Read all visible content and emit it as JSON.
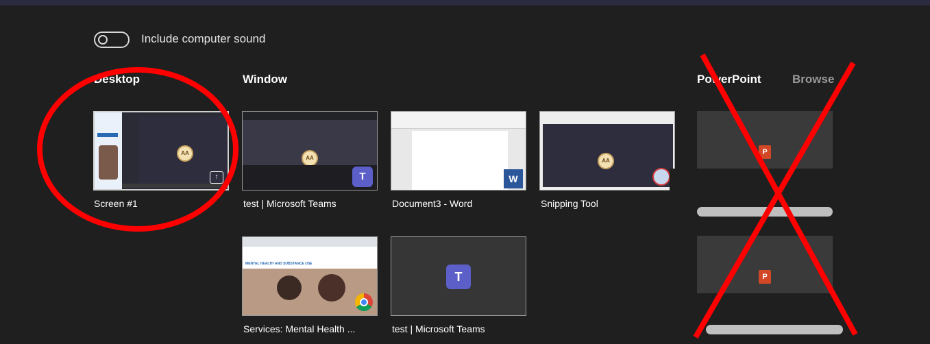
{
  "sound": {
    "label": "Include computer sound",
    "enabled": false
  },
  "sections": {
    "desktop": "Desktop",
    "window": "Window",
    "powerpoint": "PowerPoint",
    "browse": "Browse"
  },
  "desktop_items": [
    {
      "caption": "Screen #1",
      "avatar": "AA"
    }
  ],
  "window_items": [
    {
      "caption": "test | Microsoft Teams",
      "avatar": "AA",
      "badge": "T"
    },
    {
      "caption": "Document3 - Word",
      "badge": "W"
    },
    {
      "caption": "Snipping Tool",
      "avatar": "AA"
    },
    {
      "caption": "Services: Mental Health ...",
      "page_heading": "MENTAL HEALTH AND SUBSTANCE USE"
    },
    {
      "caption": "test | Microsoft Teams",
      "badge": "T"
    }
  ],
  "powerpoint_items": [
    {
      "icon": "P"
    },
    {
      "icon": "P"
    }
  ],
  "colors": {
    "annotation": "#ff0000",
    "background": "#1f1f1f",
    "teams": "#5b5fc7",
    "word": "#2b579a",
    "powerpoint": "#d24726"
  }
}
